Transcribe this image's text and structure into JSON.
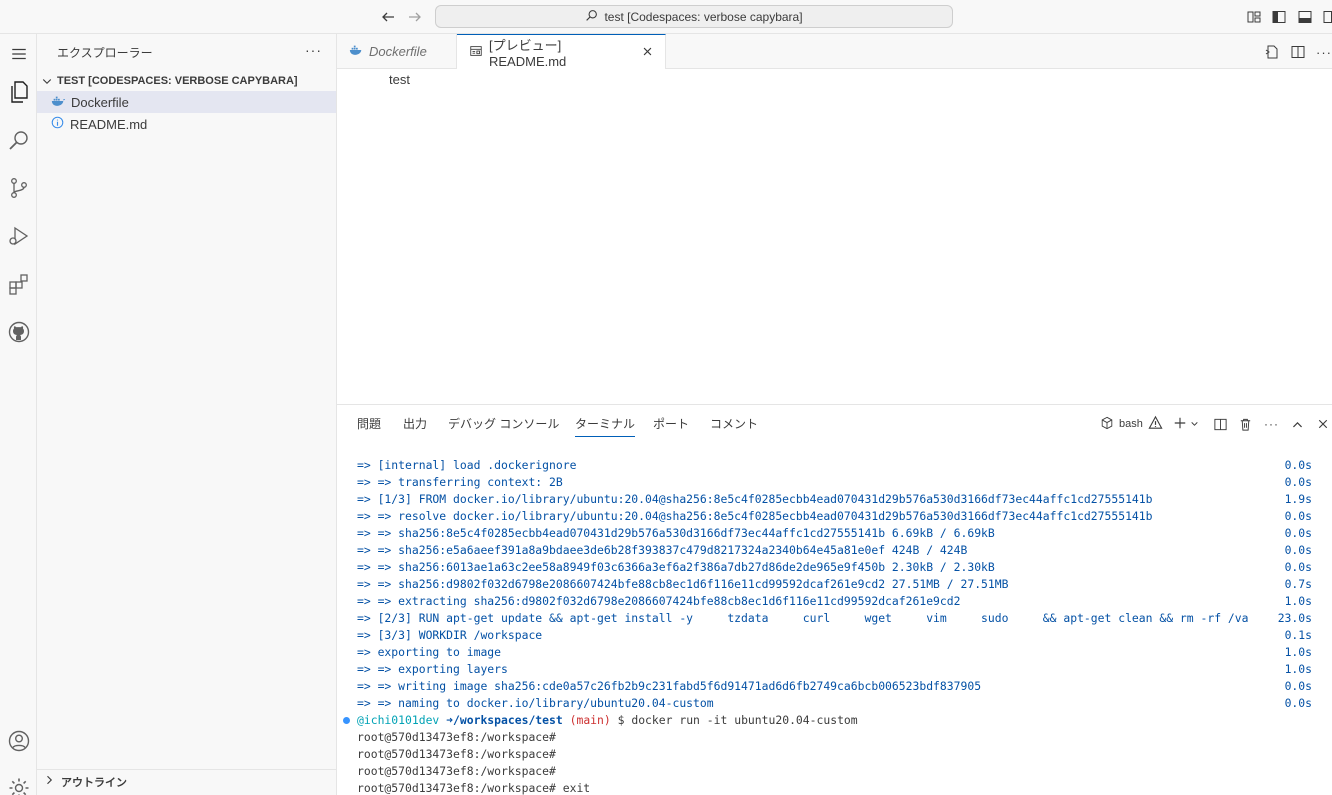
{
  "titlebar": {
    "search_text": "test [Codespaces: verbose capybara]"
  },
  "sidebar": {
    "title": "エクスプローラー",
    "more": "···",
    "folder": "TEST [CODESPACES: VERBOSE CAPYBARA]",
    "files": [
      {
        "name": "Dockerfile",
        "icon": "docker-icon",
        "selected": true
      },
      {
        "name": "README.md",
        "icon": "info-icon",
        "selected": false
      }
    ],
    "outline": "アウトライン"
  },
  "editor": {
    "tabs": [
      {
        "label": "Dockerfile",
        "active": false
      },
      {
        "label": "[プレビュー] README.md",
        "active": true
      }
    ],
    "preview_text": "test"
  },
  "panel": {
    "tabs": [
      "問題",
      "出力",
      "デバッグ コンソール",
      "ターミナル",
      "ポート",
      "コメント"
    ],
    "active_tab": "ターミナル",
    "shell": "bash"
  },
  "terminal": {
    "build_lines": [
      {
        "text": "=> [internal] load .dockerignore",
        "time": "0.0s"
      },
      {
        "text": "=> => transferring context: 2B",
        "time": "0.0s"
      },
      {
        "text": "=> [1/3] FROM docker.io/library/ubuntu:20.04@sha256:8e5c4f0285ecbb4ead070431d29b576a530d3166df73ec44affc1cd27555141b",
        "time": "1.9s"
      },
      {
        "text": "=> => resolve docker.io/library/ubuntu:20.04@sha256:8e5c4f0285ecbb4ead070431d29b576a530d3166df73ec44affc1cd27555141b",
        "time": "0.0s"
      },
      {
        "text": "=> => sha256:8e5c4f0285ecbb4ead070431d29b576a530d3166df73ec44affc1cd27555141b 6.69kB / 6.69kB",
        "time": "0.0s"
      },
      {
        "text": "=> => sha256:e5a6aeef391a8a9bdaee3de6b28f393837c479d8217324a2340b64e45a81e0ef 424B / 424B",
        "time": "0.0s"
      },
      {
        "text": "=> => sha256:6013ae1a63c2ee58a8949f03c6366a3ef6a2f386a7db27d86de2de965e9f450b 2.30kB / 2.30kB",
        "time": "0.0s"
      },
      {
        "text": "=> => sha256:d9802f032d6798e2086607424bfe88cb8ec1d6f116e11cd99592dcaf261e9cd2 27.51MB / 27.51MB",
        "time": "0.7s"
      },
      {
        "text": "=> => extracting sha256:d9802f032d6798e2086607424bfe88cb8ec1d6f116e11cd99592dcaf261e9cd2",
        "time": "1.0s"
      },
      {
        "text": "=> [2/3] RUN apt-get update && apt-get install -y     tzdata     curl     wget     vim     sudo     && apt-get clean && rm -rf /va",
        "time": "23.0s"
      },
      {
        "text": "=> [3/3] WORKDIR /workspace",
        "time": "0.1s"
      },
      {
        "text": "=> exporting to image",
        "time": "1.0s"
      },
      {
        "text": "=> => exporting layers",
        "time": "1.0s"
      },
      {
        "text": "=> => writing image sha256:cde0a57c26fb2b9c231fabd5f6d91471ad6d6fb2749ca6bcb006523bdf837905",
        "time": "0.0s"
      },
      {
        "text": "=> => naming to docker.io/library/ubuntu20.04-custom",
        "time": "0.0s"
      }
    ],
    "prompt": {
      "user": "@ichi0101dev",
      "arrow": "➜",
      "path": "/workspaces/test",
      "branch": "(main)",
      "command": "$ docker run -it ubuntu20.04-custom"
    },
    "root_lines": [
      "root@570d13473ef8:/workspace#",
      "root@570d13473ef8:/workspace#",
      "root@570d13473ef8:/workspace#",
      "root@570d13473ef8:/workspace# exit"
    ]
  },
  "colors": {
    "accent": "#005fb8",
    "selection": "#e4e6f1",
    "terminal_blue": "#0451a5",
    "prompt_cyan": "#00a2b5",
    "branch_red": "#cd3131",
    "docker_blue": "#4d8fcc"
  }
}
